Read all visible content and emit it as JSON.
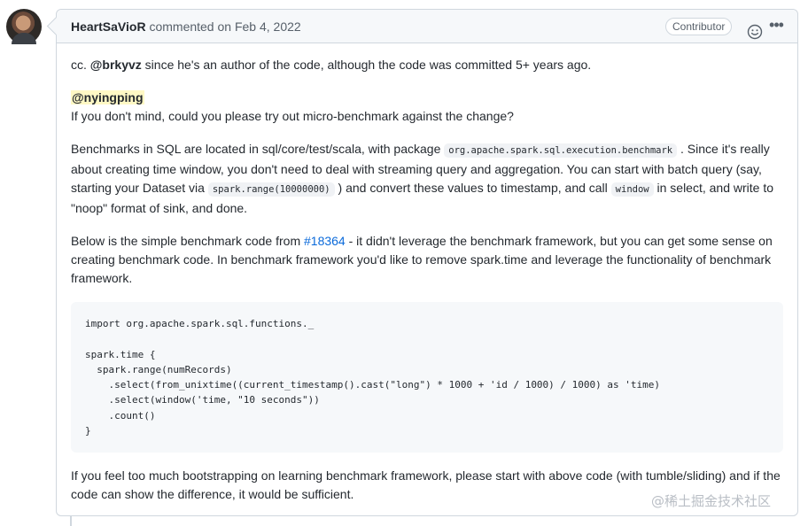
{
  "comment": {
    "author": "HeartSaVioR",
    "action": "commented on",
    "date": "Feb 4, 2022",
    "role_badge": "Contributor",
    "reaction_icon": "smiley-icon",
    "more_icon": "kebab-horizontal-icon"
  },
  "body": {
    "p1": {
      "prefix": "cc. ",
      "mention": "@brkyvz",
      "text": " since he's an author of the code, although the code was committed 5+ years ago."
    },
    "p2": {
      "mention": "@nyingping",
      "text": "If you don't mind, could you please try out micro-benchmark against the change?"
    },
    "p3": {
      "t1": "Benchmarks in SQL are located in sql/core/test/scala, with package ",
      "code1": "org.apache.spark.sql.execution.benchmark",
      "t2": " . Since it's really about creating time window, you don't need to deal with streaming query and aggregation. You can start with batch query (say, starting your Dataset via ",
      "code2": "spark.range(10000000)",
      "t3": " ) and convert these values to timestamp, and call ",
      "code3": "window",
      "t4": " in select, and write to \"noop\" format of sink, and done."
    },
    "p4": {
      "t1": "Below is the simple benchmark code from ",
      "link": "#18364",
      "t2": " - it didn't leverage the benchmark framework, but you can get some sense on creating benchmark code. In benchmark framework you'd like to remove spark.time and leverage the functionality of benchmark framework."
    },
    "code_block": "import org.apache.spark.sql.functions._\n\nspark.time {\n  spark.range(numRecords)\n    .select(from_unixtime((current_timestamp().cast(\"long\") * 1000 + 'id / 1000) / 1000) as 'time)\n    .select(window('time, \"10 seconds\"))\n    .count()\n}",
    "p5": "If you feel too much bootstrapping on learning benchmark framework, please start with above code (with tumble/sliding) and if the code can show the difference, it would be sufficient."
  },
  "watermark": "@稀土掘金技术社区"
}
